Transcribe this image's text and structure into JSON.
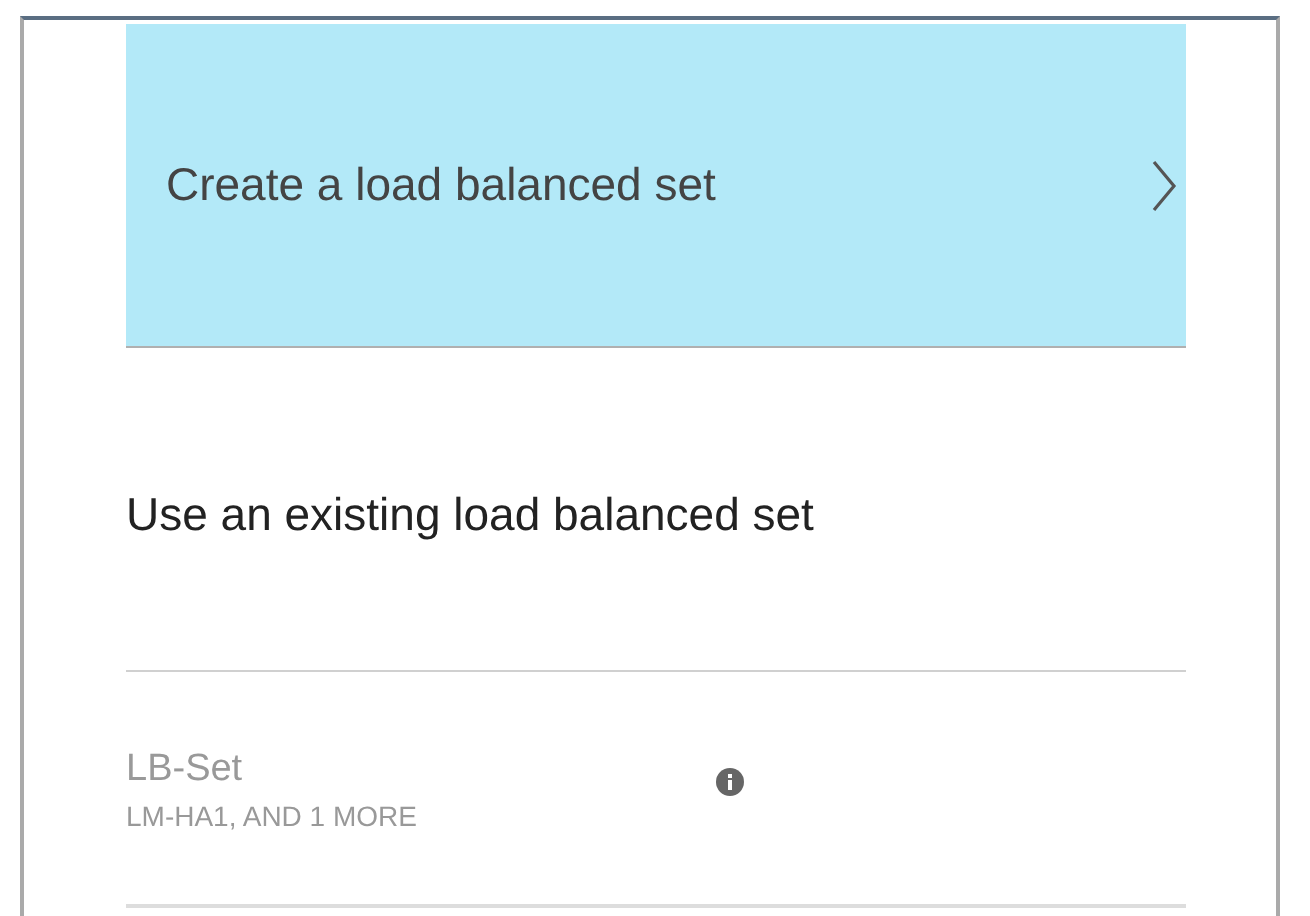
{
  "create_option": {
    "label": "Create a load balanced set",
    "selected": true
  },
  "existing_heading": "Use an existing load balanced set",
  "existing_sets": [
    {
      "name": "LB-Set",
      "members": "LM-HA1, AND 1 MORE",
      "disabled": true
    }
  ]
}
